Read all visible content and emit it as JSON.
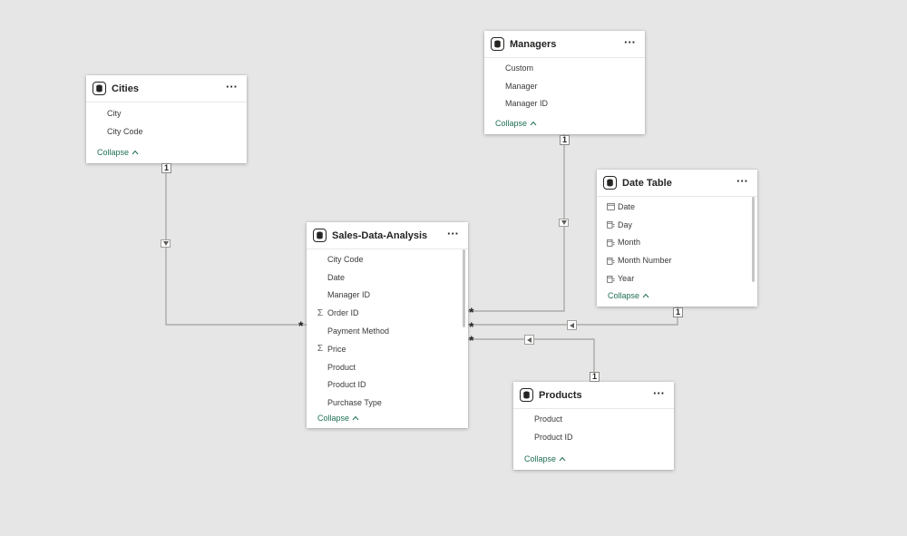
{
  "tables": {
    "cities": {
      "title": "Cities",
      "fields": [
        "City",
        "City Code"
      ],
      "collapse_label": "Collapse"
    },
    "managers": {
      "title": "Managers",
      "fields": [
        "Custom",
        "Manager",
        "Manager ID"
      ],
      "collapse_label": "Collapse"
    },
    "date_table": {
      "title": "Date Table",
      "fields": [
        "Date",
        "Day",
        "Month",
        "Month Number",
        "Year"
      ],
      "collapse_label": "Collapse"
    },
    "sales": {
      "title": "Sales-Data-Analysis",
      "fields": [
        "City Code",
        "Date",
        "Manager ID",
        "Order ID",
        "Payment Method",
        "Price",
        "Product",
        "Product ID",
        "Purchase Type"
      ],
      "collapse_label": "Collapse"
    },
    "products": {
      "title": "Products",
      "fields": [
        "Product",
        "Product ID"
      ],
      "collapse_label": "Collapse"
    }
  },
  "relationships": {
    "one_label": "1",
    "many_label": "*",
    "cities_to_sales": {
      "from": "Cities",
      "to": "Sales-Data-Analysis",
      "from_cardinality": "1",
      "to_cardinality": "*"
    },
    "managers_to_sales": {
      "from": "Managers",
      "to": "Sales-Data-Analysis",
      "from_cardinality": "1",
      "to_cardinality": "*"
    },
    "date_to_sales": {
      "from": "Date Table",
      "to": "Sales-Data-Analysis",
      "from_cardinality": "1",
      "to_cardinality": "*"
    },
    "products_to_sales": {
      "from": "Products",
      "to": "Sales-Data-Analysis",
      "from_cardinality": "1",
      "to_cardinality": "*"
    }
  },
  "icons": {
    "more": "ellipsis-icon",
    "table": "table-icon",
    "sum": "sigma-icon",
    "date": "calendar-icon",
    "hierarchy": "date-hierarchy-icon",
    "collapse": "chevron-up-icon"
  },
  "ui": {
    "more_label": "···",
    "collapse_chevron": "^",
    "sigma": "Σ"
  },
  "colors": {
    "canvas": "#e6e6e6",
    "card": "#ffffff",
    "line": "#a19f9d",
    "collapse_link": "#1f6f54"
  }
}
